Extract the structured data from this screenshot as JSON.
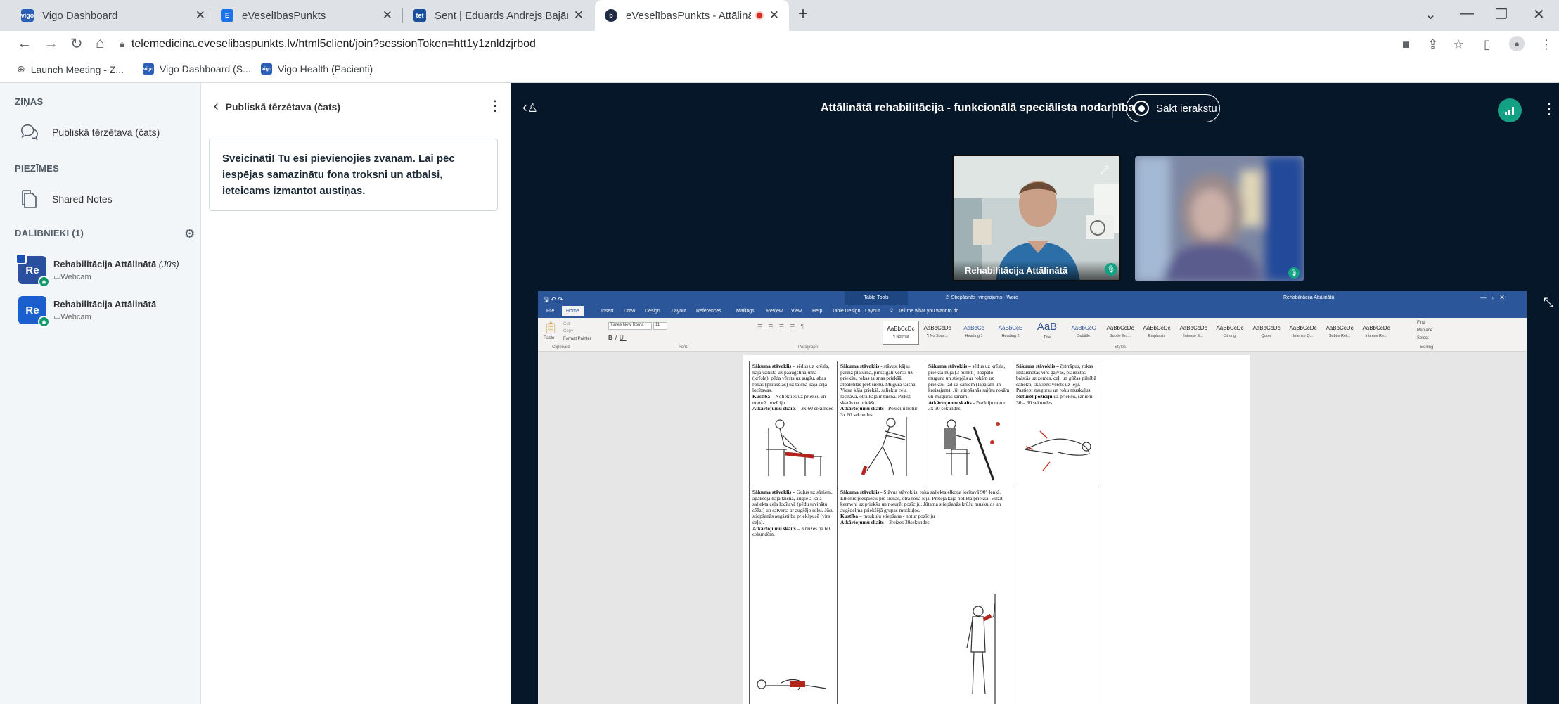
{
  "browser": {
    "tabs": [
      {
        "title": "Vigo Dashboard",
        "favicon_color": "#2b5fb7",
        "favicon_label": "vigo"
      },
      {
        "title": "eVeselībasPunkts",
        "favicon_color": "#1a73e8",
        "favicon_label": "E"
      },
      {
        "title": "Sent | Eduards Andrejs Bajārs — ",
        "favicon_color": "#1a4f9c",
        "favicon_label": "tet"
      },
      {
        "title": "eVeselībasPunkts - Attālinātā",
        "favicon_color": "#1f2a44",
        "favicon_label": "b"
      }
    ],
    "new_tab": "+",
    "url": "telemedicina.eveselibaspunkts.lv/html5client/join?sessionToken=htt1y1znldzjrbod",
    "bookmarks": [
      {
        "label": "Launch Meeting - Z...",
        "favicon_color": "#5f6368",
        "favicon_label": ""
      },
      {
        "label": "Vigo Dashboard (S...",
        "favicon_color": "#2b5fb7",
        "favicon_label": "vigo"
      },
      {
        "label": "Vigo Health (Pacienti)",
        "favicon_color": "#2b5fb7",
        "favicon_label": "vigo"
      }
    ]
  },
  "sidebar": {
    "messages_heading": "ZIŅAS",
    "public_chat": "Publiskā tērzētava (čats)",
    "notes_heading": "PIEZĪMES",
    "shared_notes": "Shared Notes",
    "participants_heading": "DALĪBNIEKI (1)",
    "participants": [
      {
        "initials": "Re",
        "name": "Rehabilitācija Attālinātā",
        "you_tag": "(Jūs)",
        "device": "Webcam",
        "presenter": true
      },
      {
        "initials": "Re",
        "name": "Rehabilitācija Attālinātā",
        "you_tag": "",
        "device": "Webcam",
        "presenter": false
      }
    ]
  },
  "chat": {
    "title": "Publiskā tērzētava (čats)",
    "welcome": "Sveicināti! Tu esi pievienojies zvanam. Lai pēc iespējas samazinātu fona troksni un atbalsi, ieteicams izmantot austiņas."
  },
  "meeting": {
    "title": "Attālinātā rehabilitācija - funkcionālā speciālista nodarbība",
    "record_label": "Sākt ierakstu",
    "webcam_user": "Rehabilitācija Attālinātā",
    "accent": "#14a083"
  },
  "word": {
    "title_center": "Table Tools",
    "doc_title": "2_Stiepšanās_vingrojums - Word",
    "user": "Rehabilitācija Attālinātā",
    "tabs": [
      "File",
      "Home",
      "Insert",
      "Draw",
      "Design",
      "Layout",
      "References",
      "Mailings",
      "Review",
      "View",
      "Help",
      "Table Design",
      "Layout"
    ],
    "tell_me": "Tell me what you want to do",
    "font_name": "Times New Roma",
    "font_size": "11",
    "clipboard": {
      "cut": "Cut",
      "copy": "Copy",
      "paste": "Paste",
      "format_painter": "Format Painter",
      "group": "Clipboard"
    },
    "groups": {
      "font": "Font",
      "paragraph": "Paragraph",
      "styles": "Styles",
      "editing": "Editing"
    },
    "styles": [
      {
        "sample": "AaBbCcDc",
        "name": "¶ Normal"
      },
      {
        "sample": "AaBbCcDc",
        "name": "¶ No Spac..."
      },
      {
        "sample": "AaBbCc",
        "name": "Heading 1"
      },
      {
        "sample": "AaBbCcE",
        "name": "Heading 2"
      },
      {
        "sample": "AaB",
        "name": "Title"
      },
      {
        "sample": "AaBbCcC",
        "name": "Subtitle"
      },
      {
        "sample": "AaBbCcDc",
        "name": "Subtle Em..."
      },
      {
        "sample": "AaBbCcDc",
        "name": "Emphasis"
      },
      {
        "sample": "AaBbCcDc",
        "name": "Intense E..."
      },
      {
        "sample": "AaBbCcDc",
        "name": "Strong"
      },
      {
        "sample": "AaBbCcDc",
        "name": "Quote"
      },
      {
        "sample": "AaBbCcDc",
        "name": "Intense Q..."
      },
      {
        "sample": "AaBbCcDc",
        "name": "Subtle Ref..."
      },
      {
        "sample": "AaBbCcDc",
        "name": "Intense Re..."
      }
    ],
    "editing": [
      "Find",
      "Replace",
      "Select"
    ],
    "cells": [
      {
        "head": "Sākuma stāvoklis –",
        "body": " sēdus uz krēsla, kāja uzlikta uz paaugstinājuma (krēsla), pēda vērsta uz augšu, abas rokas (plaukstas) uz taisnā kāja ceļa locītavas.",
        "move_head": "Kustība",
        "move_body": " – Noliekties uz priekšu un noturēt pozīciju.",
        "rep_head": "Atkārtojumu skaits",
        "rep_body": " – 3x 60 sekundes"
      },
      {
        "head": "Sākuma stāvoklis",
        "body": " - stāvus, kājas pareiz platurnā, pirkstgali vērsti uz priekšu, rokas taisnas priekšā, atbalstītas pret sienu. Mugura taisna. Viena kāja priekšā, saliekta ceļa locītavā, otra kāja ir taisna. Pirksti skatās uz priekšu.",
        "move_head": "",
        "move_body": "",
        "rep_head": "Atkārtojumu skaits",
        "rep_body": " - Pozīciju notur 3x 60 sekundes"
      },
      {
        "head": "Sākuma stāvoklis –",
        "body": " sēdus uz krēsla, priekšā nūja (3 punkti) noapalo muguru un stiepjās ar rokām uz priekšu, tad uz sāniem (labajam un kreisajam). Jūt stiepšanās sajūtu rokām un muguras sānam.",
        "move_head": "",
        "move_body": "",
        "rep_head": "Atkārtojumu skaits",
        "rep_body": " - Pozīciju notur 3x 30 sekundes"
      },
      {
        "head": "Sākuma stāvoklis –",
        "body": " četrrāpus, rokas izstaisnotas virs galvas, plaukstas balstās uz zemes, ceļi un gūžas pilnībā saliekti, skatiens vērsts uz leju. Pastiept muguras un roku muskuļus.",
        "move_head": "Noturēt pozīciju",
        "move_body": " uz priekšu, sāniem 30 – 60 sekundes.",
        "rep_head": "",
        "rep_body": ""
      },
      {
        "head": "Sākuma stāvoklis –",
        "body": " Guļus uz sāniem, apakšējā kāja taisna, augšējā kāja saliekta ceļa locītavā (pēdu tuvinātu sēžai) un satverta ar augšējo roku. Jūsu stiepšanās augšstilba priekšpusē (virs ceļa).",
        "move_head": "",
        "move_body": "",
        "rep_head": "Atkārtojumu skaits",
        "rep_body": " – 3 reizes pa 60 sekundēm."
      },
      {
        "head": "Sākuma stāvoklis",
        "body": " - Stāvus stāvoklis, roka saliekta elkoņa locītavā 90° leņķī. Elkonis piespiests pie sienas, otra roka lejā. Pretējā kāja nolikta priekšā. Virzīt ķermeni uz priekšu un noturēt pozīciju. Jūtama stiepšanās krūšu muskuļos un augšdelma priekšējā grupas muskuļos.",
        "move_head": "Kustība",
        "move_body": " – muskuļu stiepšana - notur pozīciju",
        "rep_head": "Atkārtojumu skaits",
        "rep_body": " – 3reizes 30sekundes"
      }
    ]
  }
}
